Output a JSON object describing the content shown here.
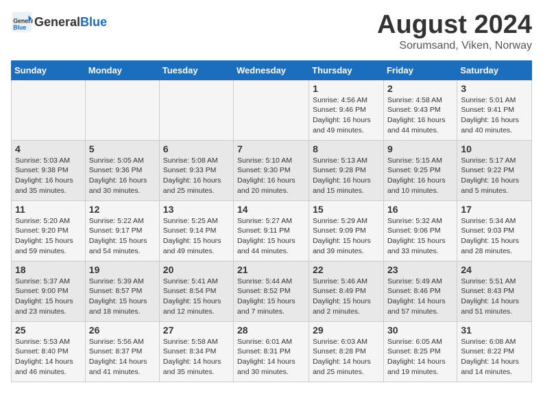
{
  "header": {
    "logo_general": "General",
    "logo_blue": "Blue",
    "title": "August 2024",
    "subtitle": "Sorumsand, Viken, Norway"
  },
  "weekdays": [
    "Sunday",
    "Monday",
    "Tuesday",
    "Wednesday",
    "Thursday",
    "Friday",
    "Saturday"
  ],
  "weeks": [
    [
      {
        "day": "",
        "info": ""
      },
      {
        "day": "",
        "info": ""
      },
      {
        "day": "",
        "info": ""
      },
      {
        "day": "",
        "info": ""
      },
      {
        "day": "1",
        "info": "Sunrise: 4:56 AM\nSunset: 9:46 PM\nDaylight: 16 hours\nand 49 minutes."
      },
      {
        "day": "2",
        "info": "Sunrise: 4:58 AM\nSunset: 9:43 PM\nDaylight: 16 hours\nand 44 minutes."
      },
      {
        "day": "3",
        "info": "Sunrise: 5:01 AM\nSunset: 9:41 PM\nDaylight: 16 hours\nand 40 minutes."
      }
    ],
    [
      {
        "day": "4",
        "info": "Sunrise: 5:03 AM\nSunset: 9:38 PM\nDaylight: 16 hours\nand 35 minutes."
      },
      {
        "day": "5",
        "info": "Sunrise: 5:05 AM\nSunset: 9:36 PM\nDaylight: 16 hours\nand 30 minutes."
      },
      {
        "day": "6",
        "info": "Sunrise: 5:08 AM\nSunset: 9:33 PM\nDaylight: 16 hours\nand 25 minutes."
      },
      {
        "day": "7",
        "info": "Sunrise: 5:10 AM\nSunset: 9:30 PM\nDaylight: 16 hours\nand 20 minutes."
      },
      {
        "day": "8",
        "info": "Sunrise: 5:13 AM\nSunset: 9:28 PM\nDaylight: 16 hours\nand 15 minutes."
      },
      {
        "day": "9",
        "info": "Sunrise: 5:15 AM\nSunset: 9:25 PM\nDaylight: 16 hours\nand 10 minutes."
      },
      {
        "day": "10",
        "info": "Sunrise: 5:17 AM\nSunset: 9:22 PM\nDaylight: 16 hours\nand 5 minutes."
      }
    ],
    [
      {
        "day": "11",
        "info": "Sunrise: 5:20 AM\nSunset: 9:20 PM\nDaylight: 15 hours\nand 59 minutes."
      },
      {
        "day": "12",
        "info": "Sunrise: 5:22 AM\nSunset: 9:17 PM\nDaylight: 15 hours\nand 54 minutes."
      },
      {
        "day": "13",
        "info": "Sunrise: 5:25 AM\nSunset: 9:14 PM\nDaylight: 15 hours\nand 49 minutes."
      },
      {
        "day": "14",
        "info": "Sunrise: 5:27 AM\nSunset: 9:11 PM\nDaylight: 15 hours\nand 44 minutes."
      },
      {
        "day": "15",
        "info": "Sunrise: 5:29 AM\nSunset: 9:09 PM\nDaylight: 15 hours\nand 39 minutes."
      },
      {
        "day": "16",
        "info": "Sunrise: 5:32 AM\nSunset: 9:06 PM\nDaylight: 15 hours\nand 33 minutes."
      },
      {
        "day": "17",
        "info": "Sunrise: 5:34 AM\nSunset: 9:03 PM\nDaylight: 15 hours\nand 28 minutes."
      }
    ],
    [
      {
        "day": "18",
        "info": "Sunrise: 5:37 AM\nSunset: 9:00 PM\nDaylight: 15 hours\nand 23 minutes."
      },
      {
        "day": "19",
        "info": "Sunrise: 5:39 AM\nSunset: 8:57 PM\nDaylight: 15 hours\nand 18 minutes."
      },
      {
        "day": "20",
        "info": "Sunrise: 5:41 AM\nSunset: 8:54 PM\nDaylight: 15 hours\nand 12 minutes."
      },
      {
        "day": "21",
        "info": "Sunrise: 5:44 AM\nSunset: 8:52 PM\nDaylight: 15 hours\nand 7 minutes."
      },
      {
        "day": "22",
        "info": "Sunrise: 5:46 AM\nSunset: 8:49 PM\nDaylight: 15 hours\nand 2 minutes."
      },
      {
        "day": "23",
        "info": "Sunrise: 5:49 AM\nSunset: 8:46 PM\nDaylight: 14 hours\nand 57 minutes."
      },
      {
        "day": "24",
        "info": "Sunrise: 5:51 AM\nSunset: 8:43 PM\nDaylight: 14 hours\nand 51 minutes."
      }
    ],
    [
      {
        "day": "25",
        "info": "Sunrise: 5:53 AM\nSunset: 8:40 PM\nDaylight: 14 hours\nand 46 minutes."
      },
      {
        "day": "26",
        "info": "Sunrise: 5:56 AM\nSunset: 8:37 PM\nDaylight: 14 hours\nand 41 minutes."
      },
      {
        "day": "27",
        "info": "Sunrise: 5:58 AM\nSunset: 8:34 PM\nDaylight: 14 hours\nand 35 minutes."
      },
      {
        "day": "28",
        "info": "Sunrise: 6:01 AM\nSunset: 8:31 PM\nDaylight: 14 hours\nand 30 minutes."
      },
      {
        "day": "29",
        "info": "Sunrise: 6:03 AM\nSunset: 8:28 PM\nDaylight: 14 hours\nand 25 minutes."
      },
      {
        "day": "30",
        "info": "Sunrise: 6:05 AM\nSunset: 8:25 PM\nDaylight: 14 hours\nand 19 minutes."
      },
      {
        "day": "31",
        "info": "Sunrise: 6:08 AM\nSunset: 8:22 PM\nDaylight: 14 hours\nand 14 minutes."
      }
    ]
  ]
}
